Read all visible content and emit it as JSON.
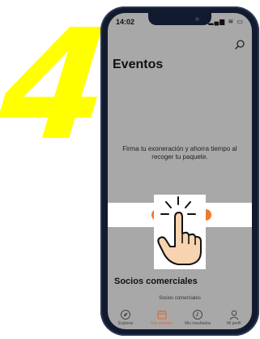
{
  "overlay": {
    "step_number": "4"
  },
  "status_bar": {
    "time": "14:02",
    "icons": "▂▄▆ ≋ ▭"
  },
  "header": {
    "title": "Eventos"
  },
  "waiver": {
    "text": "Firma tu exoneración y ahorra tiempo al recoger tu paquete."
  },
  "partners": {
    "title": "Socios comerciales",
    "label": "Socios comerciales"
  },
  "tabbar": {
    "items": [
      {
        "label": "Explorar",
        "icon": "compass-icon"
      },
      {
        "label": "Mis eventos",
        "icon": "calendar-icon"
      },
      {
        "label": "Mis resultados",
        "icon": "clock-icon"
      },
      {
        "label": "Mi perfil",
        "icon": "profile-icon"
      }
    ],
    "active_index": 1
  },
  "colors": {
    "accent": "#f07a2c",
    "overlay_yellow": "#ffff00",
    "phone_frame": "#111a2e"
  }
}
